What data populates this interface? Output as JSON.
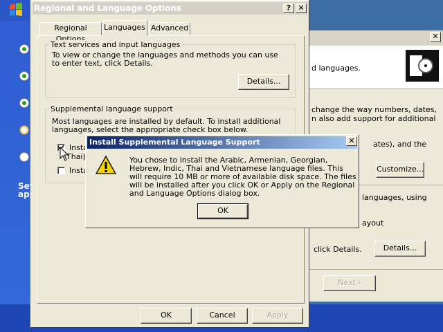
{
  "desktop": {
    "sidebar_text_lines": [
      "Set",
      "app"
    ]
  },
  "background_window": {
    "close_glyph": "✕",
    "texts": [
      "d languages.",
      "change the way numbers, dates,",
      "n also add support for additional",
      "ates), and the",
      "languages, using",
      "ayout",
      "click Details."
    ],
    "customize_label": "Customize...",
    "details_label": "Details...",
    "next_label": "Next ›"
  },
  "dialog": {
    "title": "Regional and Language Options",
    "help_glyph": "?",
    "close_glyph": "✕",
    "tabs": [
      {
        "label": "Regional Options",
        "active": false
      },
      {
        "label": "Languages",
        "active": true
      },
      {
        "label": "Advanced",
        "active": false
      }
    ],
    "text_services": {
      "group_label": "Text services and input languages",
      "description": "To view or change the languages and methods you can use to enter text, click Details.",
      "details_button": "Details..."
    },
    "supplemental": {
      "group_label": "Supplemental language support",
      "description": "Most languages are installed by default. To install additional languages, select the appropriate check box below.",
      "checkbox1_label": "Insta",
      "checkbox1_sub": "Thai)",
      "checkbox2_label": "Insta"
    },
    "buttons": {
      "ok": "OK",
      "cancel": "Cancel",
      "apply": "Apply"
    }
  },
  "popup": {
    "title": "Install Supplemental Language Support",
    "close_glyph": "✕",
    "message": "You chose to install the Arabic, Armenian, Georgian, Hebrew, Indic, Thai and Vietnamese language files. This will require 10 MB or more of available disk space. The files will be installed after you click OK or Apply on the Regional and Language Options dialog box.",
    "ok_label": "OK",
    "icon": "warning-icon"
  },
  "colors": {
    "title_gradient_start": "#0a246a",
    "title_gradient_end": "#a6caf0",
    "dialog_face": "#ece9d8",
    "desktop_blue": "#2f5ed2"
  }
}
